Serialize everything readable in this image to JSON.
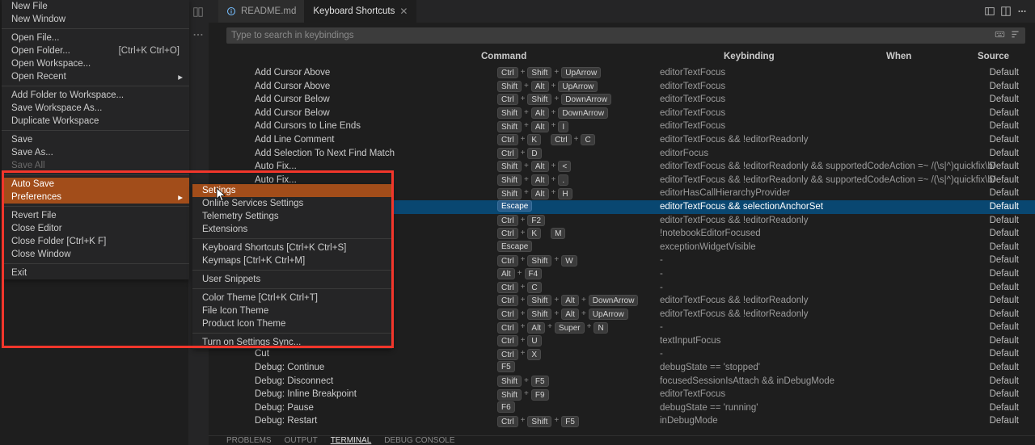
{
  "tabs": {
    "readme": "README.md",
    "kbs": "Keyboard Shortcuts"
  },
  "search": {
    "placeholder": "Type to search in keybindings"
  },
  "headers": {
    "cmd": "Command",
    "kb": "Keybinding",
    "when": "When",
    "src": "Source"
  },
  "rows": [
    {
      "cmd": "Add Cursor Above",
      "keys": [
        "Ctrl",
        "+",
        "Shift",
        "+",
        "UpArrow"
      ],
      "when": "editorTextFocus",
      "src": "Default"
    },
    {
      "cmd": "Add Cursor Above",
      "keys": [
        "Shift",
        "+",
        "Alt",
        "+",
        "UpArrow"
      ],
      "when": "editorTextFocus",
      "src": "Default"
    },
    {
      "cmd": "Add Cursor Below",
      "keys": [
        "Ctrl",
        "+",
        "Shift",
        "+",
        "DownArrow"
      ],
      "when": "editorTextFocus",
      "src": "Default"
    },
    {
      "cmd": "Add Cursor Below",
      "keys": [
        "Shift",
        "+",
        "Alt",
        "+",
        "DownArrow"
      ],
      "when": "editorTextFocus",
      "src": "Default"
    },
    {
      "cmd": "Add Cursors to Line Ends",
      "keys": [
        "Shift",
        "+",
        "Alt",
        "+",
        "I"
      ],
      "when": "editorTextFocus",
      "src": "Default"
    },
    {
      "cmd": "Add Line Comment",
      "keys": [
        "Ctrl",
        "+",
        "K",
        " ",
        "Ctrl",
        "+",
        "C"
      ],
      "when": "editorTextFocus && !editorReadonly",
      "src": "Default"
    },
    {
      "cmd": "Add Selection To Next Find Match",
      "keys": [
        "Ctrl",
        "+",
        "D"
      ],
      "when": "editorFocus",
      "src": "Default"
    },
    {
      "cmd": "Auto Fix...",
      "keys": [
        "Shift",
        "+",
        "Alt",
        "+",
        "<"
      ],
      "when": "editorTextFocus && !editorReadonly && supportedCodeAction =~ /(\\s|^)quickfix\\b/",
      "src": "Default"
    },
    {
      "cmd": "Auto Fix...",
      "keys": [
        "Shift",
        "+",
        "Alt",
        "+",
        "."
      ],
      "when": "editorTextFocus && !editorReadonly && supportedCodeAction =~ /(\\s|^)quickfix\\b/",
      "src": "Default"
    },
    {
      "cmd": "",
      "keys": [
        "Shift",
        "+",
        "Alt",
        "+",
        "H"
      ],
      "when": "editorHasCallHierarchyProvider",
      "src": "Default"
    },
    {
      "cmd": "",
      "keys": [
        "Escape"
      ],
      "when": "editorTextFocus && selectionAnchorSet",
      "src": "Default",
      "sel": true
    },
    {
      "cmd": "",
      "keys": [
        "Ctrl",
        "+",
        "F2"
      ],
      "when": "editorTextFocus && !editorReadonly",
      "src": "Default"
    },
    {
      "cmd": "",
      "keys": [
        "Ctrl",
        "+",
        "K",
        " ",
        "M"
      ],
      "when": "!notebookEditorFocused",
      "src": "Default"
    },
    {
      "cmd": "",
      "keys": [
        "Escape"
      ],
      "when": "exceptionWidgetVisible",
      "src": "Default"
    },
    {
      "cmd": "",
      "keys": [
        "Ctrl",
        "+",
        "Shift",
        "+",
        "W"
      ],
      "when": "-",
      "src": "Default"
    },
    {
      "cmd": "",
      "keys": [
        "Alt",
        "+",
        "F4"
      ],
      "when": "-",
      "src": "Default"
    },
    {
      "cmd": "",
      "keys": [
        "Ctrl",
        "+",
        "C"
      ],
      "when": "-",
      "src": "Default"
    },
    {
      "cmd": "",
      "keys": [
        "Ctrl",
        "+",
        "Shift",
        "+",
        "Alt",
        "+",
        "DownArrow"
      ],
      "when": "editorTextFocus && !editorReadonly",
      "src": "Default"
    },
    {
      "cmd": "",
      "keys": [
        "Ctrl",
        "+",
        "Shift",
        "+",
        "Alt",
        "+",
        "UpArrow"
      ],
      "when": "editorTextFocus && !editorReadonly",
      "src": "Default"
    },
    {
      "cmd": "",
      "keys": [
        "Ctrl",
        "+",
        "Alt",
        "+",
        "Super",
        "+",
        "N"
      ],
      "when": "-",
      "src": "Default"
    },
    {
      "cmd": "",
      "keys": [
        "Ctrl",
        "+",
        "U"
      ],
      "when": "textInputFocus",
      "src": "Default"
    },
    {
      "cmd": "Cut",
      "keys": [
        "Ctrl",
        "+",
        "X"
      ],
      "when": "-",
      "src": "Default"
    },
    {
      "cmd": "Debug: Continue",
      "keys": [
        "F5"
      ],
      "when": "debugState == 'stopped'",
      "src": "Default"
    },
    {
      "cmd": "Debug: Disconnect",
      "keys": [
        "Shift",
        "+",
        "F5"
      ],
      "when": "focusedSessionIsAttach && inDebugMode",
      "src": "Default"
    },
    {
      "cmd": "Debug: Inline Breakpoint",
      "keys": [
        "Shift",
        "+",
        "F9"
      ],
      "when": "editorTextFocus",
      "src": "Default"
    },
    {
      "cmd": "Debug: Pause",
      "keys": [
        "F6"
      ],
      "when": "debugState == 'running'",
      "src": "Default"
    },
    {
      "cmd": "Debug: Restart",
      "keys": [
        "Ctrl",
        "+",
        "Shift",
        "+",
        "F5"
      ],
      "when": "inDebugMode",
      "src": "Default"
    }
  ],
  "fileMenu": [
    {
      "t": "New File"
    },
    {
      "t": "New Window"
    },
    {
      "sep": true
    },
    {
      "t": "Open File..."
    },
    {
      "t": "Open Folder...",
      "s": "[Ctrl+K Ctrl+O]"
    },
    {
      "t": "Open Workspace..."
    },
    {
      "t": "Open Recent",
      "sub": true
    },
    {
      "sep": true
    },
    {
      "t": "Add Folder to Workspace..."
    },
    {
      "t": "Save Workspace As..."
    },
    {
      "t": "Duplicate Workspace"
    },
    {
      "sep": true
    },
    {
      "t": "Save"
    },
    {
      "t": "Save As..."
    },
    {
      "t": "Save All",
      "disabled": true
    },
    {
      "sep": true
    },
    {
      "t": "Auto Save",
      "hl": true
    },
    {
      "t": "Preferences",
      "sub": true,
      "hover": true
    },
    {
      "sep": true
    },
    {
      "t": "Revert File"
    },
    {
      "t": "Close Editor"
    },
    {
      "t": "Close Folder [Ctrl+K F]"
    },
    {
      "t": "Close Window"
    },
    {
      "sep": true
    },
    {
      "t": "Exit"
    }
  ],
  "subMenu": [
    {
      "t": "Settings",
      "hover": true
    },
    {
      "t": "Online Services Settings"
    },
    {
      "t": "Telemetry Settings"
    },
    {
      "t": "Extensions"
    },
    {
      "sep": true
    },
    {
      "t": "Keyboard Shortcuts [Ctrl+K Ctrl+S]"
    },
    {
      "t": "Keymaps [Ctrl+K Ctrl+M]"
    },
    {
      "sep": true
    },
    {
      "t": "User Snippets"
    },
    {
      "sep": true
    },
    {
      "t": "Color Theme [Ctrl+K Ctrl+T]"
    },
    {
      "t": "File Icon Theme"
    },
    {
      "t": "Product Icon Theme"
    },
    {
      "sep": true
    },
    {
      "t": "Turn on Settings Sync..."
    }
  ],
  "panel": {
    "problems": "PROBLEMS",
    "output": "OUTPUT",
    "terminal": "TERMINAL",
    "debug": "DEBUG CONSOLE"
  }
}
